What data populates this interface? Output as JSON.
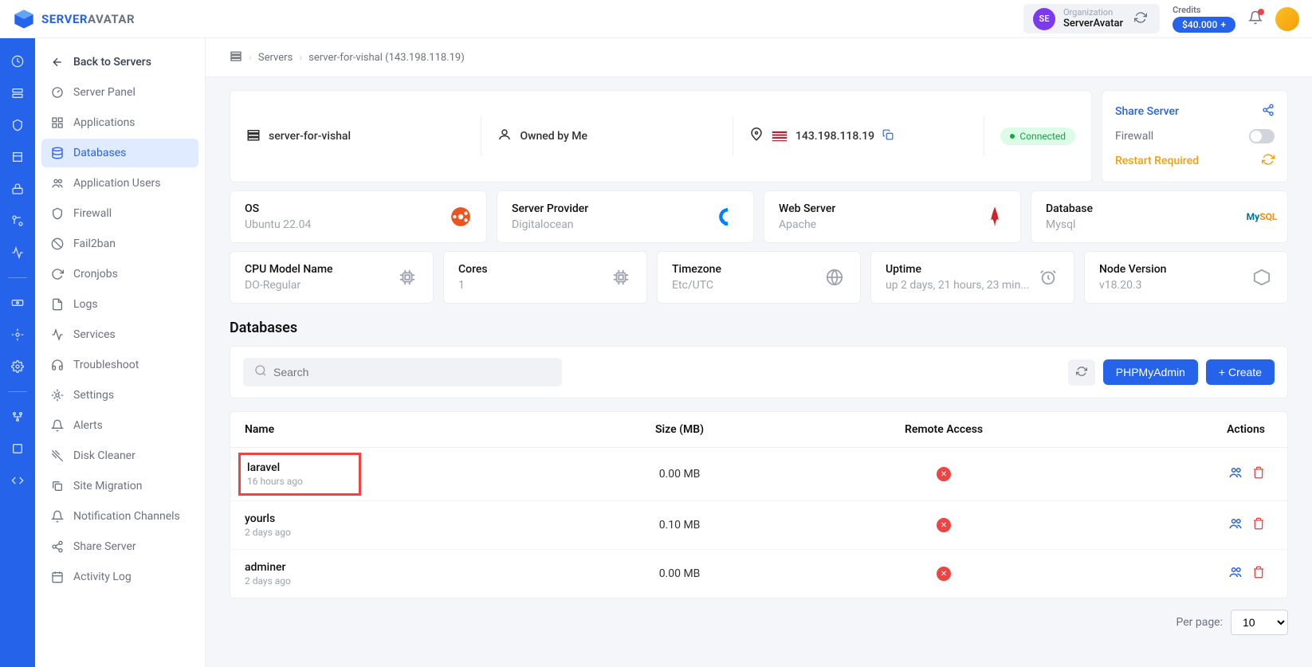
{
  "brand": {
    "name1": "SERVER",
    "name2": "AVATAR"
  },
  "header": {
    "org_label": "Organization",
    "org_name": "ServerAvatar",
    "org_badge": "SE",
    "credits_label": "Credits",
    "credits_amount": "$40.000"
  },
  "breadcrumb": {
    "servers": "Servers",
    "current": "server-for-vishal (143.198.118.19)"
  },
  "sidebar": {
    "back": "Back to Servers",
    "items": [
      "Server Panel",
      "Applications",
      "Databases",
      "Application Users",
      "Firewall",
      "Fail2ban",
      "Cronjobs",
      "Logs",
      "Services",
      "Troubleshoot",
      "Settings",
      "Alerts",
      "Disk Cleaner",
      "Site Migration",
      "Notification Channels",
      "Share Server",
      "Activity Log"
    ],
    "active_index": 2
  },
  "server": {
    "name": "server-for-vishal",
    "owned": "Owned by Me",
    "ip": "143.198.118.19",
    "status": "Connected",
    "share": "Share Server",
    "firewall": "Firewall",
    "restart": "Restart Required"
  },
  "info1": [
    {
      "label": "OS",
      "value": "Ubuntu 22.04",
      "icon": "ubuntu"
    },
    {
      "label": "Server Provider",
      "value": "Digitalocean",
      "icon": "digitalocean"
    },
    {
      "label": "Web Server",
      "value": "Apache",
      "icon": "apache"
    },
    {
      "label": "Database",
      "value": "Mysql",
      "icon": "mysql"
    }
  ],
  "info2": [
    {
      "label": "CPU Model Name",
      "value": "DO-Regular",
      "icon": "cpu"
    },
    {
      "label": "Cores",
      "value": "1",
      "icon": "chip"
    },
    {
      "label": "Timezone",
      "value": "Etc/UTC",
      "icon": "globe"
    },
    {
      "label": "Uptime",
      "value": "up 2 days, 21 hours, 23 min...",
      "icon": "clock"
    },
    {
      "label": "Node Version",
      "value": "v18.20.3",
      "icon": "node"
    }
  ],
  "section_title": "Databases",
  "search_placeholder": "Search",
  "buttons": {
    "phpmyadmin": "PHPMyAdmin",
    "create": "Create"
  },
  "table": {
    "headers": {
      "name": "Name",
      "size": "Size (MB)",
      "remote": "Remote Access",
      "actions": "Actions"
    },
    "rows": [
      {
        "name": "laravel",
        "time": "16 hours ago",
        "size": "0.00 MB",
        "highlight": true
      },
      {
        "name": "yourls",
        "time": "2 days ago",
        "size": "0.10 MB",
        "highlight": false
      },
      {
        "name": "adminer",
        "time": "2 days ago",
        "size": "0.00 MB",
        "highlight": false
      }
    ]
  },
  "pager": {
    "label": "Per page:",
    "value": "10"
  }
}
